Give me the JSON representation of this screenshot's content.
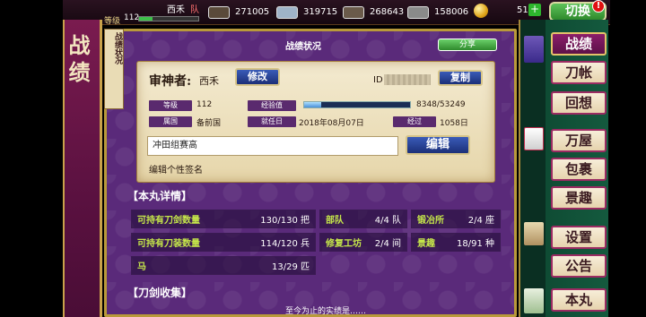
{
  "top_bar": {
    "player_name": "西禾",
    "player_tag": "队",
    "level_label": "等级",
    "level_value": "112",
    "level_progress": 0.22,
    "resources": [
      {
        "name": "charcoal",
        "value": "271005",
        "color": "#5a4a3a"
      },
      {
        "name": "cooling-water",
        "value": "319715",
        "color": "#9fb3c8"
      },
      {
        "name": "whetstone",
        "value": "268643",
        "color": "#6a5a4a"
      },
      {
        "name": "jade-steel",
        "value": "158006",
        "color": "#8a8a8a"
      }
    ],
    "coin_value": "51",
    "coin_add_label": "+",
    "switch_label": "切换",
    "alert_label": "!"
  },
  "side_banner": {
    "label": "战绩"
  },
  "panel": {
    "scroll_label": "战绩状况",
    "title": "战绩状况",
    "share_label": "分享"
  },
  "profile": {
    "saniwa_label": "审神者:",
    "saniwa_name": "西禾",
    "edit_label": "修改",
    "id_label": "ID",
    "copy_label": "复制",
    "level_label": "等级",
    "level_value": "112",
    "exp_label": "经验值",
    "exp_value": "8348/53249",
    "exp_progress": 0.157,
    "country_label": "属国",
    "country_value": "备前国",
    "appointed_label": "就任日",
    "appointed_value": "2018年08月07日",
    "elapsed_label": "经过",
    "elapsed_value": "1058日",
    "signature_value": "冲田组赛高",
    "signature_edit_label": "编辑",
    "signature_hint": "编辑个性签名"
  },
  "details": {
    "heading": "【本丸详情】",
    "rows": [
      {
        "label": "可持有刀剑数量",
        "value": "130/130 把"
      },
      {
        "label": "可持有刀装数量",
        "value": "114/120 兵"
      },
      {
        "label": "马",
        "value": "13/29 匹"
      },
      {
        "label": "部队",
        "value": "4/4 队"
      },
      {
        "label": "锻冶所",
        "value": "2/4 座"
      },
      {
        "label": "修复工坊",
        "value": "2/4 间"
      },
      {
        "label": "景趣",
        "value": "18/91 种"
      }
    ]
  },
  "collection": {
    "heading": "【刀剑收集】",
    "footer": "至今为止的实绩是……"
  },
  "nav": {
    "items": [
      {
        "label": "战绩",
        "active": true
      },
      {
        "label": "刀帐",
        "active": false
      },
      {
        "label": "回想",
        "active": false
      },
      {
        "label": "万屋",
        "active": false
      },
      {
        "label": "包裹",
        "active": false
      },
      {
        "label": "景趣",
        "active": false
      },
      {
        "label": "设置",
        "active": false
      },
      {
        "label": "公告",
        "active": false
      },
      {
        "label": "本丸",
        "active": false
      }
    ]
  }
}
